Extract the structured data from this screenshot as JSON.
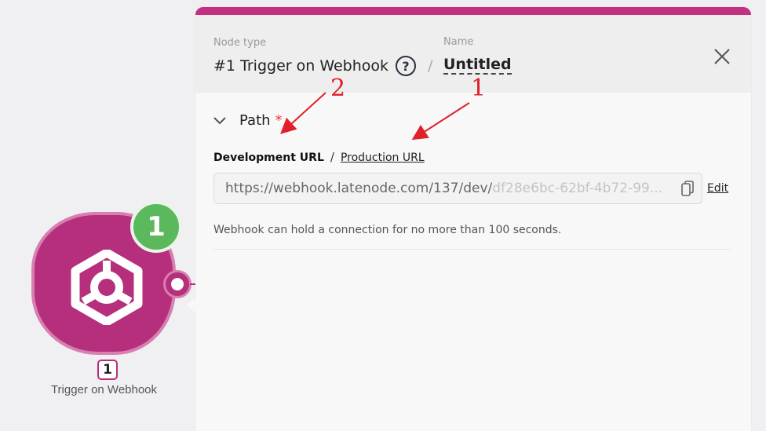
{
  "canvas": {
    "node": {
      "badge": "1",
      "index": "1",
      "label": "Trigger on Webhook"
    }
  },
  "panel": {
    "header": {
      "node_type_label": "Node type",
      "node_type_value": "#1 Trigger on Webhook",
      "help_glyph": "?",
      "separator": "/",
      "name_label": "Name",
      "name_value": "Untitled",
      "close_icon": "close-icon"
    },
    "path": {
      "title": "Path",
      "required_mark": "*",
      "tabs": {
        "development": "Development URL",
        "separator": "/",
        "production": "Production URL"
      },
      "url_base": "https://webhook.latenode.com/137/dev/",
      "url_tail": "df28e6bc-62bf-4b72-99...",
      "copy_icon": "copy-icon",
      "edit_label": "Edit",
      "hint": "Webhook can hold a connection for no more than 100 seconds."
    }
  },
  "annotations": {
    "label_1": "1",
    "label_2": "2",
    "color": "#e0202a"
  },
  "colors": {
    "accent": "#c2307f",
    "node_fill": "#b52f7c",
    "badge_green": "#5cb85c"
  }
}
